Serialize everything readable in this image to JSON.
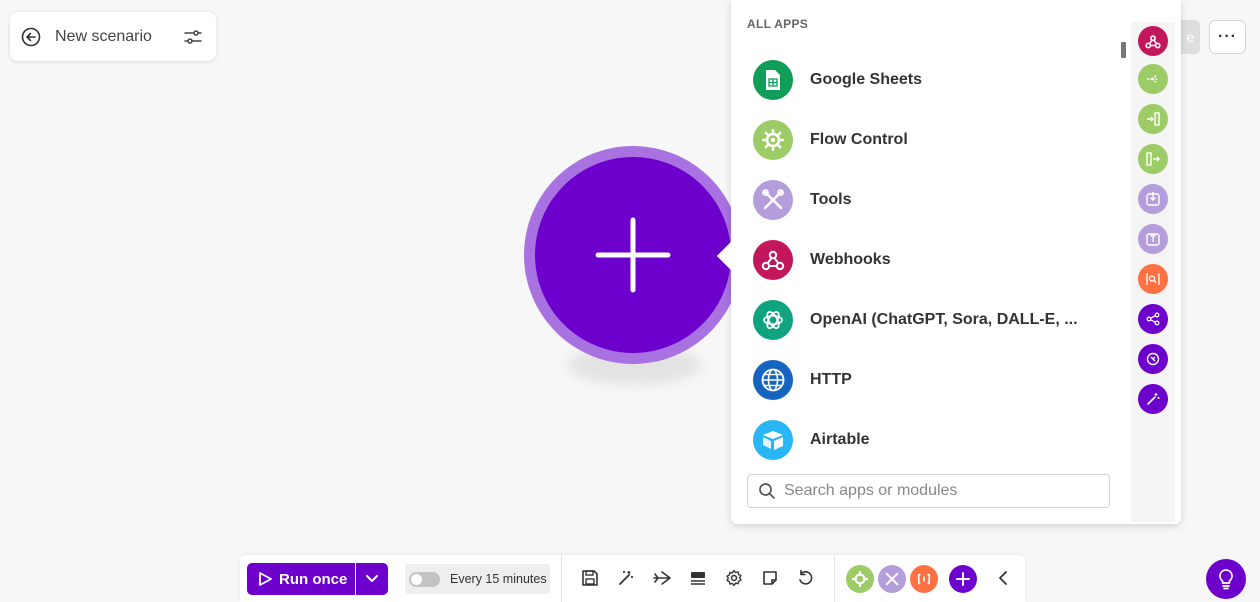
{
  "scenario": {
    "title": "New scenario"
  },
  "header": {
    "save_label_fragment": "e",
    "more_label": "···"
  },
  "apps_panel": {
    "header": "ALL APPS",
    "apps": [
      {
        "name": "Google Sheets",
        "icon": "google-sheets-icon",
        "color": "#0f9d58"
      },
      {
        "name": "Flow Control",
        "icon": "gear-icon",
        "color": "#9ccc65"
      },
      {
        "name": "Tools",
        "icon": "tools-icon",
        "color": "#b39ddb"
      },
      {
        "name": "Webhooks",
        "icon": "webhooks-icon",
        "color": "#c2185b"
      },
      {
        "name": "OpenAI (ChatGPT, Sora, DALL-E, ...",
        "icon": "openai-icon",
        "color": "#10a37f"
      },
      {
        "name": "HTTP",
        "icon": "globe-icon",
        "color": "#1565c0"
      },
      {
        "name": "Airtable",
        "icon": "airtable-icon",
        "color": "#29b6f6"
      }
    ],
    "search_placeholder": "Search apps or modules",
    "quick_buttons": [
      {
        "icon": "webhooks-icon",
        "color": "#c2185b"
      },
      {
        "icon": "router-icon",
        "color": "#9ccc65"
      },
      {
        "icon": "iterator-icon",
        "color": "#9ccc65"
      },
      {
        "icon": "aggregator-icon",
        "color": "#9ccc65"
      },
      {
        "icon": "import-icon",
        "color": "#b39ddb"
      },
      {
        "icon": "export-icon",
        "color": "#b39ddb"
      },
      {
        "icon": "text-parser-icon",
        "color": "#ff7043"
      },
      {
        "icon": "share-icon",
        "color": "#6d00cc"
      },
      {
        "icon": "target-icon",
        "color": "#6d00cc"
      },
      {
        "icon": "magic-wand-icon",
        "color": "#6d00cc"
      }
    ]
  },
  "toolbar": {
    "run_once_label": "Run once",
    "schedule_label": "Every 15 minutes",
    "schedule_enabled": false
  },
  "colors": {
    "brand": "#6d00cc",
    "brand_light": "#a872e0",
    "canvas": "#f7f7f7"
  }
}
